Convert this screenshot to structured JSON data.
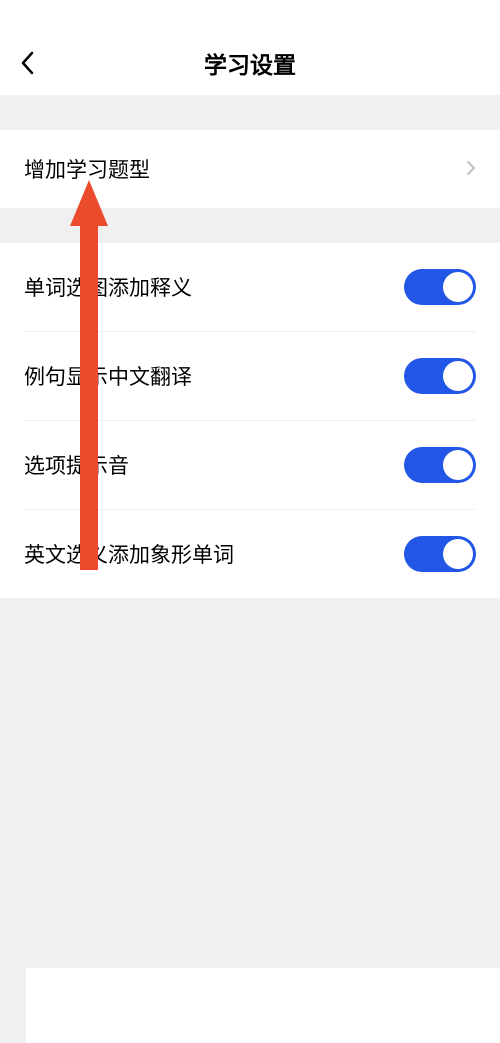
{
  "header": {
    "title": "学习设置"
  },
  "nav": {
    "add_question_types_label": "增加学习题型"
  },
  "toggles": {
    "word_image_definition": {
      "label": "单词选图添加释义",
      "on": true
    },
    "example_chinese_translation": {
      "label": "例句显示中文翻译",
      "on": true
    },
    "option_sound": {
      "label": "选项提示音",
      "on": true
    },
    "english_pictograph_word": {
      "label": "英文选义添加象形单词",
      "on": true
    }
  },
  "colors": {
    "accent": "#2156e6",
    "annotation": "#e94b2c"
  }
}
